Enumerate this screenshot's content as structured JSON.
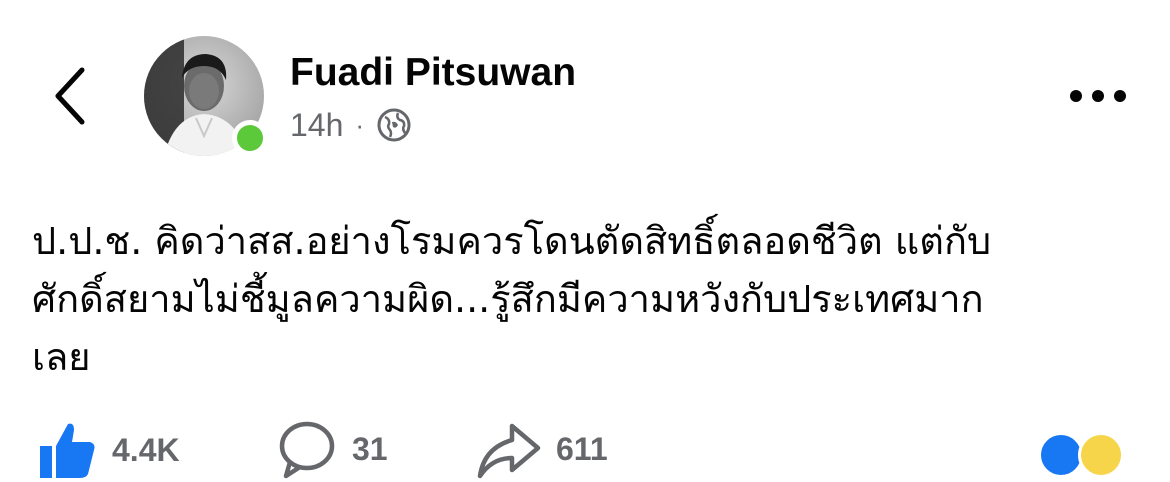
{
  "header": {
    "author_name": "Fuadi Pitsuwan",
    "timestamp": "14h",
    "separator": "·",
    "audience_icon": "globe-icon",
    "back_icon": "chevron-left-icon",
    "more_icon": "more-horizontal-icon",
    "online_status_color": "#5cc93b"
  },
  "post": {
    "text": "ป.ป.ช. คิดว่าสส.อย่างโรมควรโดนตัดสิทธิ์ตลอดชีวิต แต่กับ\nศักดิ์สยามไม่ชี้มูลความผิด...รู้สึกมีความหวังกับประเทศมาก\nเลย"
  },
  "actions": {
    "like": {
      "icon": "thumbs-up-icon",
      "count": "4.4K"
    },
    "comment": {
      "icon": "comment-icon",
      "count": "31"
    },
    "share": {
      "icon": "share-icon",
      "count": "611"
    }
  },
  "reactions": [
    "like-reaction-icon",
    "haha-reaction-icon"
  ],
  "colors": {
    "text_primary": "#050505",
    "text_secondary": "#65676b",
    "like_blue": "#1877f2"
  }
}
